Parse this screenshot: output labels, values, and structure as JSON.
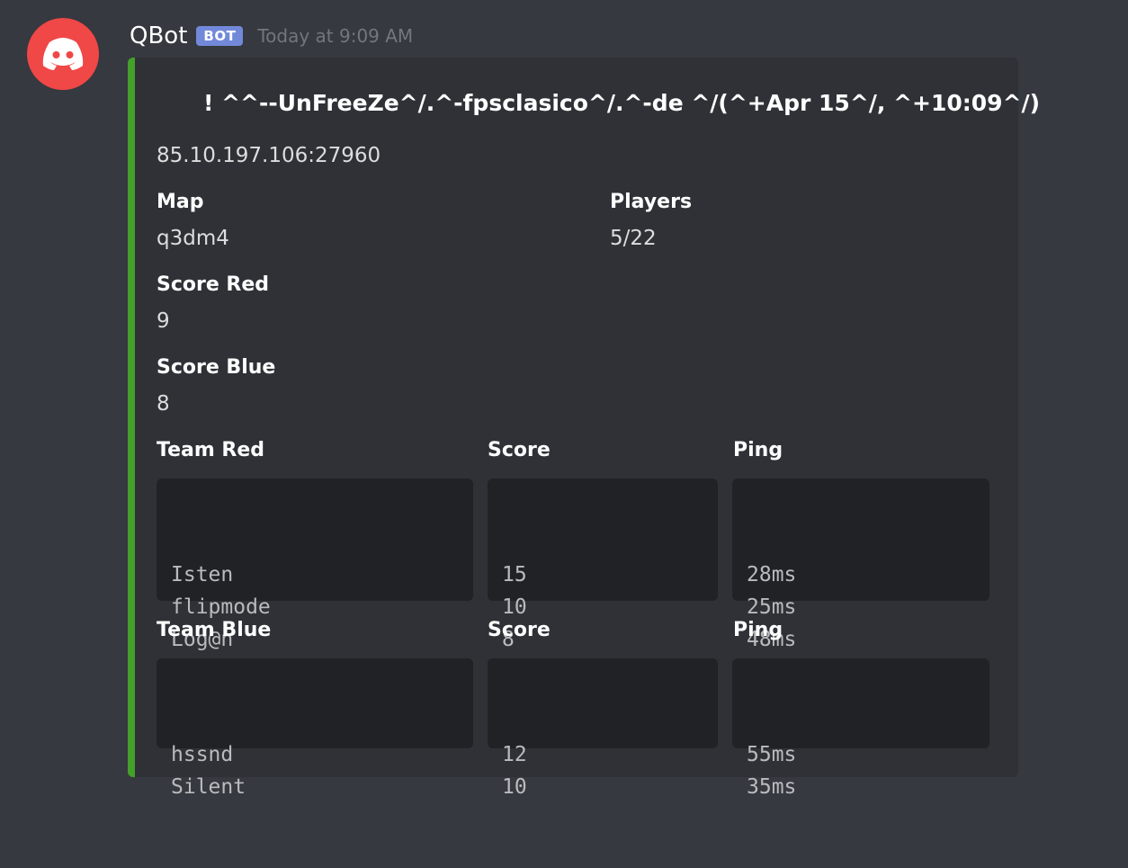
{
  "message": {
    "username": "QBot",
    "bot_tag": "BOT",
    "timestamp": "Today at 9:09 AM",
    "accent_color": "#43a02a",
    "avatar_icon": "discord-logo-icon"
  },
  "embed": {
    "title": "! ^^--UnFreeZe^/.^-fpsclasico^/.^-de ^/(^+Apr 15^/, ^+10:09^/)",
    "description": "85.10.197.106:27960",
    "map": {
      "name": "Map",
      "value": "q3dm4"
    },
    "players": {
      "name": "Players",
      "value": "5/22"
    },
    "score_red": {
      "name": "Score Red",
      "value": "9"
    },
    "score_blue": {
      "name": "Score Blue",
      "value": "8"
    },
    "team_red": {
      "name": "Team Red",
      "score_label": "Score",
      "ping_label": "Ping",
      "players": [
        "Isten",
        "flipmode",
        "Log@n"
      ],
      "scores": [
        "15",
        "10",
        "8"
      ],
      "pings": [
        "28ms",
        "25ms",
        "48ms"
      ]
    },
    "team_blue": {
      "name": "Team Blue",
      "score_label": "Score",
      "ping_label": "Ping",
      "players": [
        "hssnd",
        "Silent"
      ],
      "scores": [
        "12",
        "10"
      ],
      "pings": [
        "55ms",
        "35ms"
      ]
    }
  }
}
